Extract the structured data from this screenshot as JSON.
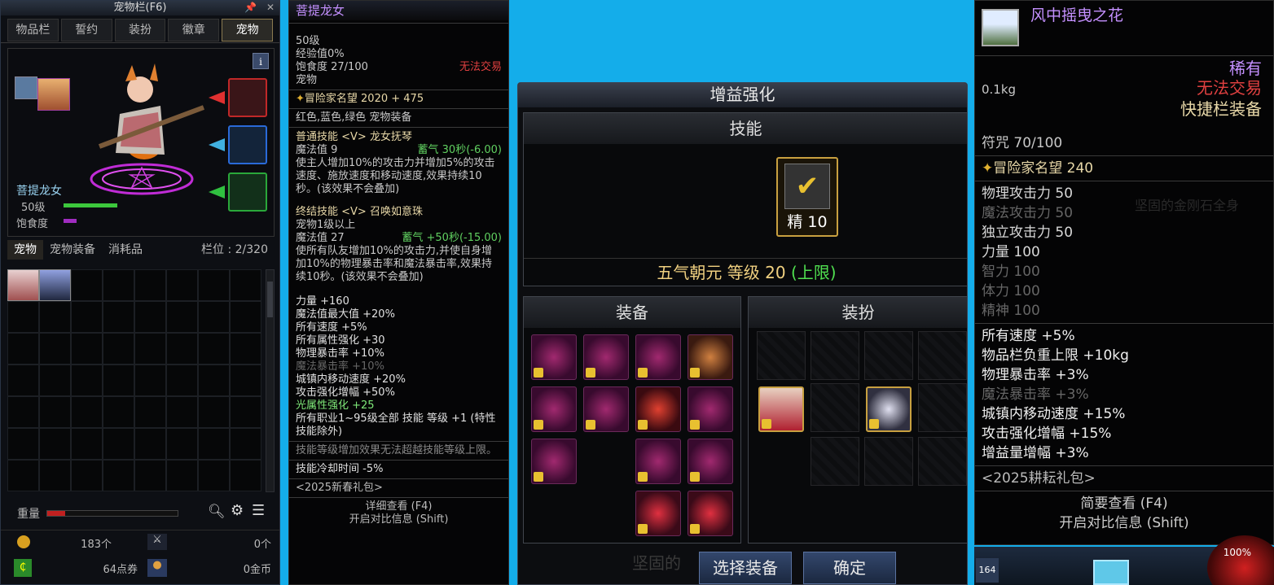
{
  "pet_window": {
    "title": "宠物栏(F6)",
    "tabs": [
      "物品栏",
      "誓约",
      "装扮",
      "徽章",
      "宠物"
    ],
    "info_icon": "i",
    "pet_name": "菩提龙女",
    "pet_level": "50级",
    "satiety_label": "饱食度",
    "subtabs": [
      "宠物",
      "宠物装备",
      "消耗品"
    ],
    "slots_label": "栏位 : 2/320",
    "weight_label": "重量",
    "currency": {
      "row1_left": "183个",
      "row1_right": "0个",
      "row2_left": "64点券",
      "row2_right": "0金币"
    }
  },
  "tooltip_pet": {
    "name": "菩提龙女",
    "level": "50级",
    "exp": "经验值0%",
    "satiety": "饱食度 27/100",
    "no_trade": "无法交易",
    "type": "宠物",
    "reputation": "冒险家名望 2020 + 475",
    "colors": "红色,蓝色,绿色 宠物装备",
    "skill1_name": "普通技能 <V> 龙女抚琴",
    "skill1_mp": "魔法值 9",
    "skill1_cd": "蓄气 30秒(-6.00)",
    "skill1_desc": "使主人增加10%的攻击力并增加5%的攻击速度、施放速度和移动速度,效果持续10秒。(该效果不会叠加)",
    "skill2_name": "终结技能 <V> 召唤如意珠",
    "skill2_req": "宠物1级以上",
    "skill2_mp": "魔法值 27",
    "skill2_cd": "蓄气 +50秒(-15.00)",
    "skill2_desc": "使所有队友增加10%的攻击力,并使自身增加10%的物理暴击率和魔法暴击率,效果持续10秒。(该效果不会叠加)",
    "stats": [
      "力量 +160",
      "魔法值最大值 +20%",
      "所有速度 +5%",
      "所有属性强化 +30",
      "物理暴击率 +10%",
      "魔法暴击率 +10%",
      "城镇内移动速度 +20%",
      "攻击强化增幅 +50%",
      "光属性强化 +25",
      "所有职业1~95级全部 技能 等级 +1 (特性技能除外)"
    ],
    "note": "技能等级增加效果无法超越技能等级上限。",
    "cooldown": "技能冷却时间 -5%",
    "package": "<2025新春礼包>",
    "footer1": "详细查看 (F4)",
    "footer2": "开启对比信息 (Shift)"
  },
  "enhance": {
    "title": "增益强化",
    "skill_header": "技能",
    "skill_badge": "精 10",
    "skill_name": "五气朝元 等级 20",
    "skill_limit": "(上限)",
    "equip_header": "装备",
    "avatar_header": "装扮",
    "bg_text": "坚固的",
    "select_btn": "选择装备",
    "confirm_btn": "确定"
  },
  "tooltip_flower": {
    "name": "风中摇曳之花",
    "rarity": "稀有",
    "weight": "0.1kg",
    "no_trade": "无法交易",
    "quick": "快捷栏装备",
    "charm": "符咒 70/100",
    "reputation": "冒险家名望 240",
    "stats_grey": [
      "物理攻击力 50",
      "魔法攻击力 50",
      "独立攻击力 50",
      "力量 100",
      "智力 100",
      "体力 100",
      "精神 100"
    ],
    "stats_bonus": [
      "所有速度 +5%",
      "物品栏负重上限 +10kg",
      "物理暴击率 +3%",
      "魔法暴击率 +3%",
      "城镇内移动速度 +15%",
      "攻击强化增幅 +15%",
      "增益量增幅 +3%"
    ],
    "package": "<2025耕耘礼包>",
    "footer1": "简要查看 (F4)",
    "footer2": "开启对比信息 (Shift)",
    "bottom_badge": "164",
    "bottom_pct": "100%",
    "bg_text": "坚固的金刚石全身"
  }
}
